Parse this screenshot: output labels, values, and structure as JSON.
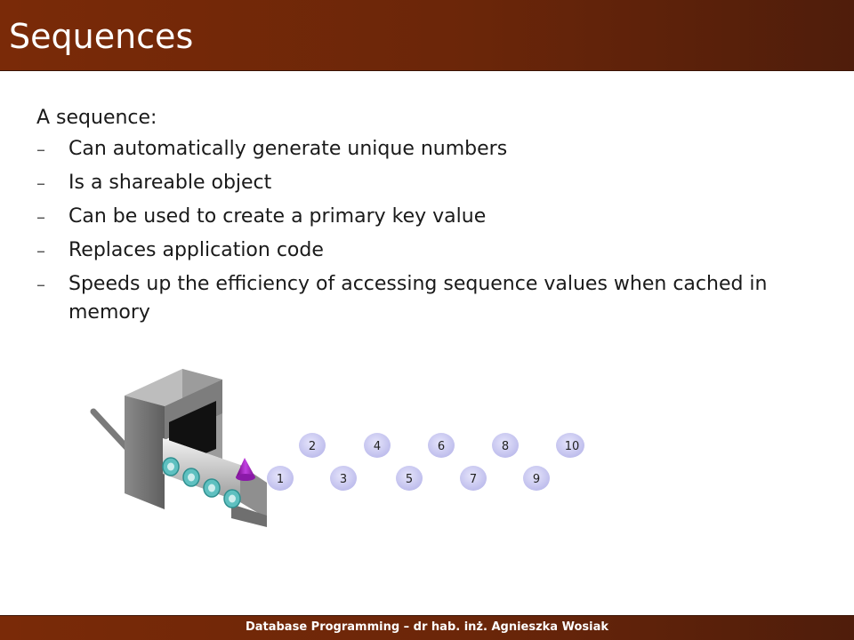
{
  "slide": {
    "title": "Sequences",
    "lead": "A sequence:",
    "bullets": [
      "Can automatically generate unique numbers",
      "Is a shareable object",
      "Can be used to create a primary key value",
      "Replaces application code",
      "Speeds up the efficiency of accessing sequence values when cached in memory"
    ],
    "bullet_marker": "–"
  },
  "illustration": {
    "numbers": [
      "1",
      "2",
      "3",
      "4",
      "5",
      "6",
      "7",
      "8",
      "9",
      "10"
    ]
  },
  "footer": {
    "text": "Database Programming – dr hab. inż. Agnieszka Wosiak"
  },
  "colors": {
    "bar": "#6b2609",
    "bubble": "#c9c8f2",
    "cone": "#a020c0",
    "rollers": "#7fd0d0"
  }
}
